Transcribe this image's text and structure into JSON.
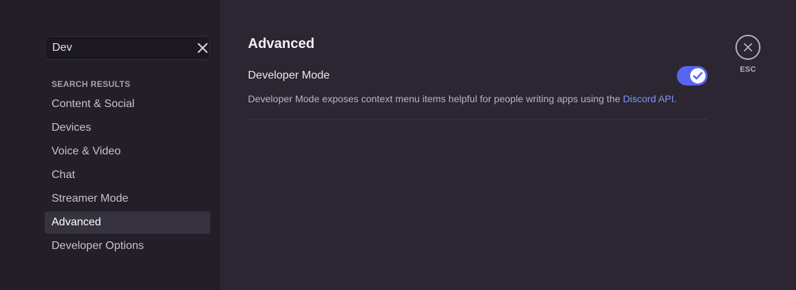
{
  "search": {
    "value": "Dev",
    "clear_icon": "close-icon"
  },
  "sidebar": {
    "section_header": "SEARCH RESULTS",
    "items": [
      {
        "label": "Content & Social"
      },
      {
        "label": "Devices"
      },
      {
        "label": "Voice & Video"
      },
      {
        "label": "Chat"
      },
      {
        "label": "Streamer Mode"
      },
      {
        "label": "Advanced",
        "selected": true
      },
      {
        "label": "Developer Options"
      }
    ]
  },
  "main": {
    "title": "Advanced",
    "setting": {
      "label": "Developer Mode",
      "enabled": true,
      "description_prefix": "Developer Mode exposes context menu items helpful for people writing apps using the ",
      "link_text": "Discord API",
      "description_suffix": "."
    }
  },
  "close": {
    "icon": "close-icon",
    "label": "ESC"
  },
  "colors": {
    "accent": "#5865f2",
    "link": "#7d9bf5",
    "sidebar_bg": "#231f29",
    "content_bg": "#2c2633"
  }
}
